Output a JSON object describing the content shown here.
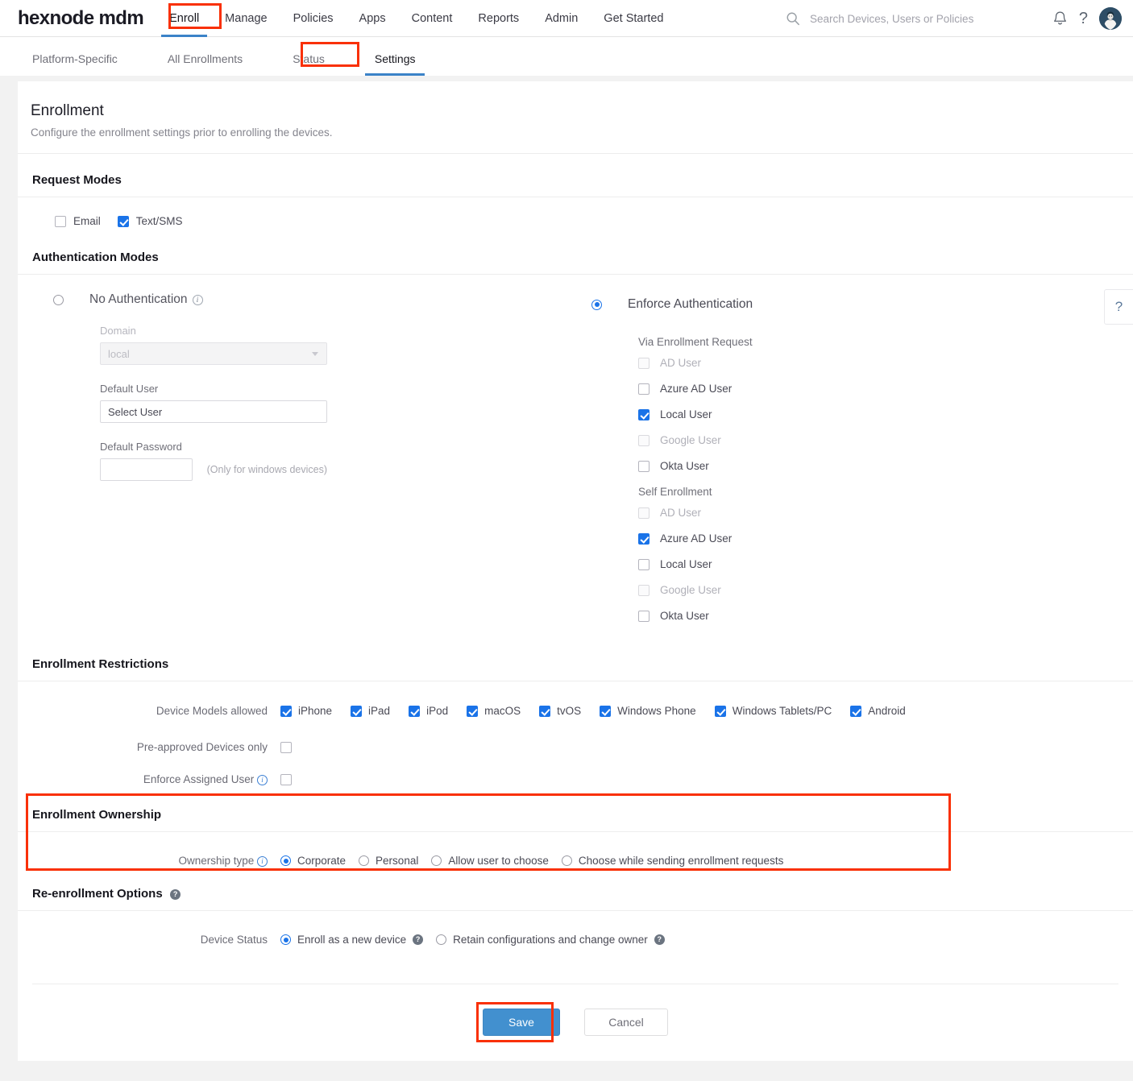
{
  "topnav": {
    "brand": "hexnode mdm",
    "items": [
      {
        "label": "Enroll",
        "active": true
      },
      {
        "label": "Manage",
        "active": false
      },
      {
        "label": "Policies",
        "active": false
      },
      {
        "label": "Apps",
        "active": false
      },
      {
        "label": "Content",
        "active": false
      },
      {
        "label": "Reports",
        "active": false
      },
      {
        "label": "Admin",
        "active": false
      },
      {
        "label": "Get Started",
        "active": false
      }
    ],
    "search_placeholder": "Search Devices, Users or Policies",
    "search_value": "",
    "icons": {
      "search": "search-icon",
      "bell": "bell-icon",
      "help": "?",
      "avatar": "avatar"
    }
  },
  "tabs": [
    {
      "label": "Platform-Specific",
      "active": false
    },
    {
      "label": "All Enrollments",
      "active": false
    },
    {
      "label": "Status",
      "active": false
    },
    {
      "label": "Settings",
      "active": true
    }
  ],
  "page": {
    "title": "Enrollment",
    "subtitle": "Configure the enrollment settings prior to enrolling the devices."
  },
  "request_modes": {
    "section_title": "Request Modes",
    "options": [
      {
        "label": "Email",
        "checked": false,
        "disabled": false
      },
      {
        "label": "Text/SMS",
        "checked": true,
        "disabled": false
      }
    ]
  },
  "authentication_modes": {
    "section_title": "Authentication Modes",
    "no_auth": {
      "label": "No Authentication",
      "selected": false,
      "info": "i",
      "domain_label": "Domain",
      "domain_value": "local",
      "default_user_label": "Default User",
      "default_user_value": "Select User",
      "default_password_label": "Default Password",
      "default_password_value": "",
      "password_note": "(Only for windows devices)"
    },
    "enforce_auth": {
      "label": "Enforce Authentication",
      "selected": true,
      "groups": [
        {
          "title": "Via Enrollment Request",
          "options": [
            {
              "label": "AD User",
              "checked": false,
              "disabled": true
            },
            {
              "label": "Azure AD User",
              "checked": false,
              "disabled": false
            },
            {
              "label": "Local User",
              "checked": true,
              "disabled": false
            },
            {
              "label": "Google User",
              "checked": false,
              "disabled": true
            },
            {
              "label": "Okta User",
              "checked": false,
              "disabled": false
            }
          ]
        },
        {
          "title": "Self Enrollment",
          "options": [
            {
              "label": "AD User",
              "checked": false,
              "disabled": true
            },
            {
              "label": "Azure AD User",
              "checked": true,
              "disabled": false
            },
            {
              "label": "Local User",
              "checked": false,
              "disabled": false
            },
            {
              "label": "Google User",
              "checked": false,
              "disabled": true
            },
            {
              "label": "Okta User",
              "checked": false,
              "disabled": false
            }
          ]
        }
      ]
    }
  },
  "enrollment_restrictions": {
    "section_title": "Enrollment Restrictions",
    "device_models_label": "Device Models allowed",
    "device_models": [
      {
        "label": "iPhone",
        "checked": true
      },
      {
        "label": "iPad",
        "checked": true
      },
      {
        "label": "iPod",
        "checked": true
      },
      {
        "label": "macOS",
        "checked": true
      },
      {
        "label": "tvOS",
        "checked": true
      },
      {
        "label": "Windows Phone",
        "checked": true
      },
      {
        "label": "Windows Tablets/PC",
        "checked": true
      },
      {
        "label": "Android",
        "checked": true
      }
    ],
    "pre_approved_label": "Pre-approved Devices only",
    "pre_approved_checked": false,
    "enforce_assigned_label": "Enforce Assigned User",
    "enforce_assigned_checked": false
  },
  "enrollment_ownership": {
    "section_title": "Enrollment Ownership",
    "ownership_type_label": "Ownership type",
    "options": [
      {
        "label": "Corporate",
        "selected": true
      },
      {
        "label": "Personal",
        "selected": false
      },
      {
        "label": "Allow user to choose",
        "selected": false
      },
      {
        "label": "Choose while sending enrollment requests",
        "selected": false
      }
    ]
  },
  "reenrollment_options": {
    "section_title": "Re-enrollment Options",
    "device_status_label": "Device Status",
    "options": [
      {
        "label": "Enroll as a new device",
        "selected": true
      },
      {
        "label": "Retain configurations and change owner",
        "selected": false
      }
    ]
  },
  "footer": {
    "save_label": "Save",
    "cancel_label": "Cancel"
  },
  "side_help": {
    "label": "?"
  },
  "highlight_color": "#f93005"
}
